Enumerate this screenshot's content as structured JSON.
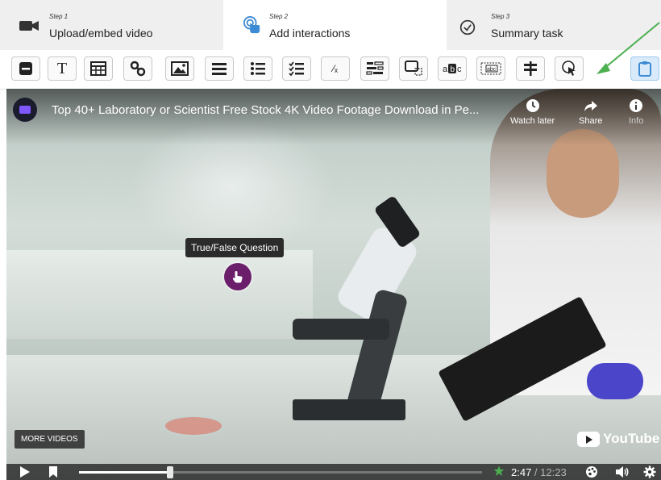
{
  "steps": [
    {
      "small": "Step 1",
      "label": "Upload/embed video",
      "icon": "video-camera-icon"
    },
    {
      "small": "Step 2",
      "label": "Add interactions",
      "icon": "touch-pointer-icon"
    },
    {
      "small": "Step 3",
      "label": "Summary task",
      "icon": "check-circle-icon"
    }
  ],
  "toolbar": {
    "text_tool": "T",
    "fraction_tool": "⁄ₓ",
    "active_tool": "paste-icon",
    "accent": "#3d8bd4"
  },
  "video": {
    "title": "Top 40+ Laboratory or Scientist Free Stock 4K Video Footage Download in Pe...",
    "watch_later": "Watch later",
    "share": "Share",
    "info": "Info",
    "interaction_label": "True/False Question",
    "more_videos": "MORE VIDEOS",
    "brand": "YouTube",
    "current_time": "2:47",
    "duration": " / 12:23",
    "progress_fraction": 0.225,
    "hotspot_color": "#6b1f6b"
  },
  "annotation": {
    "arrow_color": "#4caf50"
  }
}
